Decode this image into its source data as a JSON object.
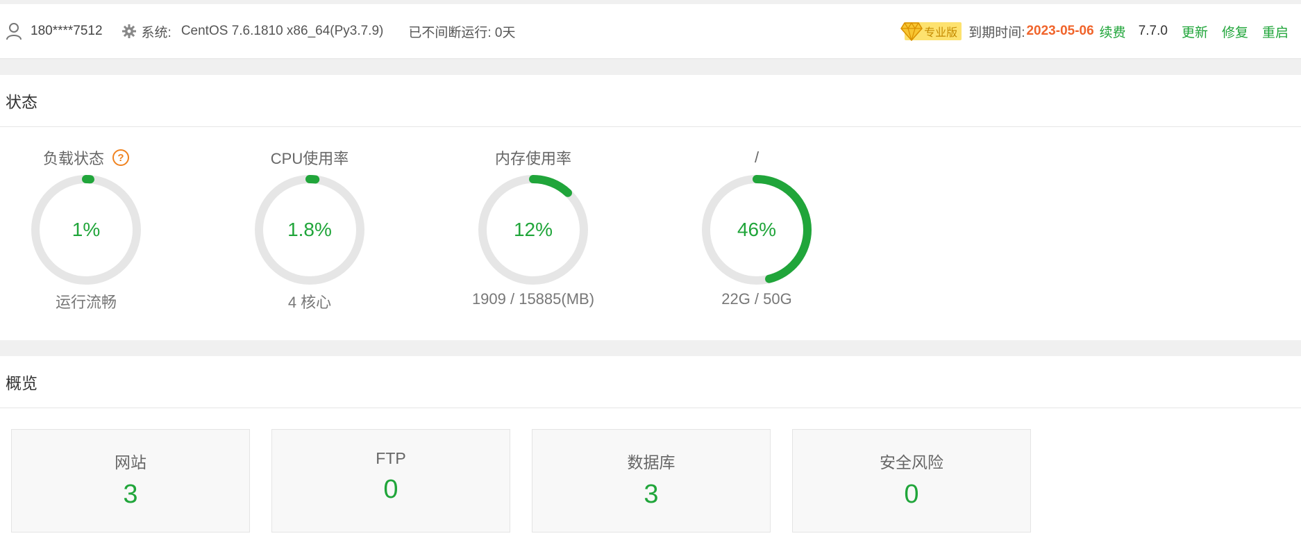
{
  "topbar": {
    "user": "180****7512",
    "system_label": "系统:",
    "system_value": "CentOS 7.6.1810 x86_64(Py3.7.9)",
    "uptime": "已不间断运行: 0天",
    "pro_badge": "专业版",
    "expire_label": "到期时间:",
    "expire_date": "2023-05-06",
    "renew": "续费",
    "version": "7.7.0",
    "update": "更新",
    "repair": "修复",
    "restart": "重启",
    "icons": {
      "user": "user-icon",
      "system": "gear-icon",
      "pro": "diamond-icon"
    }
  },
  "status": {
    "title": "状态",
    "gauges": [
      {
        "title": "负载状态",
        "value": "1%",
        "percent": 1,
        "sub": "运行流畅",
        "has_help": true
      },
      {
        "title": "CPU使用率",
        "value": "1.8%",
        "percent": 1.8,
        "sub": "4 核心",
        "has_help": false
      },
      {
        "title": "内存使用率",
        "value": "12%",
        "percent": 12,
        "sub": "1909 / 15885(MB)",
        "has_help": false
      },
      {
        "title": "/",
        "value": "46%",
        "percent": 46,
        "sub": "22G / 50G",
        "has_help": false
      }
    ]
  },
  "overview": {
    "title": "概览",
    "cards": [
      {
        "label": "网站",
        "value": "3"
      },
      {
        "label": "FTP",
        "value": "0"
      },
      {
        "label": "数据库",
        "value": "3"
      },
      {
        "label": "安全风险",
        "value": "0"
      }
    ]
  },
  "colors": {
    "accent": "#20a53a",
    "warning": "#f0642b",
    "ring_track": "#e6e6e6"
  }
}
